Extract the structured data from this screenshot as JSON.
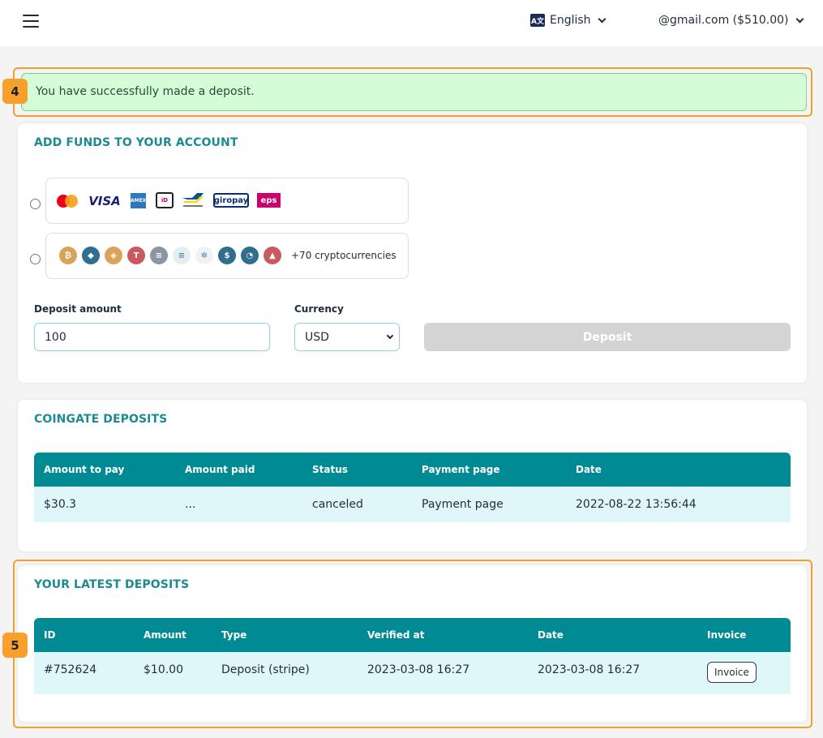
{
  "header": {
    "language": "English",
    "account": "@gmail.com ($510.00)"
  },
  "markers": {
    "alert": "4",
    "latest": "5"
  },
  "alert": {
    "message": "You have successfully made a deposit."
  },
  "add_funds": {
    "title": "ADD FUNDS TO YOUR ACCOUNT",
    "card_methods": [
      "mastercard",
      "VISA",
      "amex",
      "iDEAL",
      "bancontact",
      "giropay",
      "eps"
    ],
    "crypto_label": "+70 cryptocurrencies",
    "crypto_coins": [
      "bitcoin",
      "ethereum",
      "bnb",
      "tron",
      "stacks",
      "solana",
      "cardano",
      "usdc",
      "celo",
      "avalanche"
    ],
    "deposit_amount_label": "Deposit amount",
    "deposit_amount_value": "100",
    "currency_label": "Currency",
    "currency_value": "USD",
    "deposit_button": "Deposit"
  },
  "coingate": {
    "title": "COINGATE DEPOSITS",
    "columns": [
      "Amount to pay",
      "Amount paid",
      "Status",
      "Payment page",
      "Date"
    ],
    "rows": [
      [
        "$30.3",
        "...",
        "canceled",
        "Payment page",
        "2022-08-22 13:56:44"
      ]
    ]
  },
  "latest": {
    "title": "YOUR LATEST DEPOSITS",
    "columns": [
      "ID",
      "Amount",
      "Type",
      "Verified at",
      "Date",
      "Invoice"
    ],
    "rows": [
      [
        "#752624",
        "$10.00",
        "Deposit (stripe)",
        "2023-03-08 16:27",
        "2023-03-08 16:27",
        "Invoice"
      ]
    ]
  },
  "colors": {
    "accent": "#008a93",
    "highlight": "#f0a030",
    "success_bg": "#d4fcd6"
  }
}
